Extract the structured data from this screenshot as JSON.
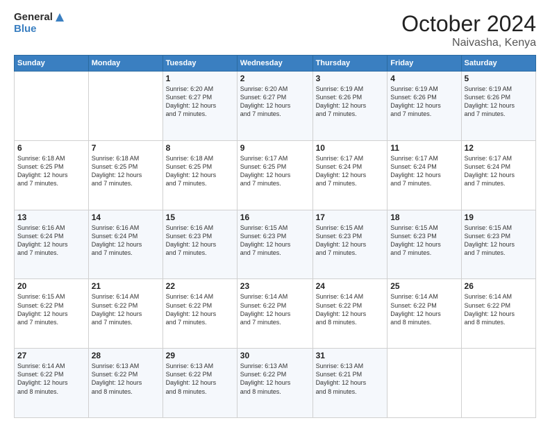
{
  "header": {
    "logo_text_general": "General",
    "logo_text_blue": "Blue",
    "month": "October 2024",
    "location": "Naivasha, Kenya"
  },
  "days_of_week": [
    "Sunday",
    "Monday",
    "Tuesday",
    "Wednesday",
    "Thursday",
    "Friday",
    "Saturday"
  ],
  "weeks": [
    [
      {
        "day": "",
        "info": ""
      },
      {
        "day": "",
        "info": ""
      },
      {
        "day": "1",
        "info": "Sunrise: 6:20 AM\nSunset: 6:27 PM\nDaylight: 12 hours\nand 7 minutes."
      },
      {
        "day": "2",
        "info": "Sunrise: 6:20 AM\nSunset: 6:27 PM\nDaylight: 12 hours\nand 7 minutes."
      },
      {
        "day": "3",
        "info": "Sunrise: 6:19 AM\nSunset: 6:26 PM\nDaylight: 12 hours\nand 7 minutes."
      },
      {
        "day": "4",
        "info": "Sunrise: 6:19 AM\nSunset: 6:26 PM\nDaylight: 12 hours\nand 7 minutes."
      },
      {
        "day": "5",
        "info": "Sunrise: 6:19 AM\nSunset: 6:26 PM\nDaylight: 12 hours\nand 7 minutes."
      }
    ],
    [
      {
        "day": "6",
        "info": "Sunrise: 6:18 AM\nSunset: 6:25 PM\nDaylight: 12 hours\nand 7 minutes."
      },
      {
        "day": "7",
        "info": "Sunrise: 6:18 AM\nSunset: 6:25 PM\nDaylight: 12 hours\nand 7 minutes."
      },
      {
        "day": "8",
        "info": "Sunrise: 6:18 AM\nSunset: 6:25 PM\nDaylight: 12 hours\nand 7 minutes."
      },
      {
        "day": "9",
        "info": "Sunrise: 6:17 AM\nSunset: 6:25 PM\nDaylight: 12 hours\nand 7 minutes."
      },
      {
        "day": "10",
        "info": "Sunrise: 6:17 AM\nSunset: 6:24 PM\nDaylight: 12 hours\nand 7 minutes."
      },
      {
        "day": "11",
        "info": "Sunrise: 6:17 AM\nSunset: 6:24 PM\nDaylight: 12 hours\nand 7 minutes."
      },
      {
        "day": "12",
        "info": "Sunrise: 6:17 AM\nSunset: 6:24 PM\nDaylight: 12 hours\nand 7 minutes."
      }
    ],
    [
      {
        "day": "13",
        "info": "Sunrise: 6:16 AM\nSunset: 6:24 PM\nDaylight: 12 hours\nand 7 minutes."
      },
      {
        "day": "14",
        "info": "Sunrise: 6:16 AM\nSunset: 6:24 PM\nDaylight: 12 hours\nand 7 minutes."
      },
      {
        "day": "15",
        "info": "Sunrise: 6:16 AM\nSunset: 6:23 PM\nDaylight: 12 hours\nand 7 minutes."
      },
      {
        "day": "16",
        "info": "Sunrise: 6:15 AM\nSunset: 6:23 PM\nDaylight: 12 hours\nand 7 minutes."
      },
      {
        "day": "17",
        "info": "Sunrise: 6:15 AM\nSunset: 6:23 PM\nDaylight: 12 hours\nand 7 minutes."
      },
      {
        "day": "18",
        "info": "Sunrise: 6:15 AM\nSunset: 6:23 PM\nDaylight: 12 hours\nand 7 minutes."
      },
      {
        "day": "19",
        "info": "Sunrise: 6:15 AM\nSunset: 6:23 PM\nDaylight: 12 hours\nand 7 minutes."
      }
    ],
    [
      {
        "day": "20",
        "info": "Sunrise: 6:15 AM\nSunset: 6:22 PM\nDaylight: 12 hours\nand 7 minutes."
      },
      {
        "day": "21",
        "info": "Sunrise: 6:14 AM\nSunset: 6:22 PM\nDaylight: 12 hours\nand 7 minutes."
      },
      {
        "day": "22",
        "info": "Sunrise: 6:14 AM\nSunset: 6:22 PM\nDaylight: 12 hours\nand 7 minutes."
      },
      {
        "day": "23",
        "info": "Sunrise: 6:14 AM\nSunset: 6:22 PM\nDaylight: 12 hours\nand 7 minutes."
      },
      {
        "day": "24",
        "info": "Sunrise: 6:14 AM\nSunset: 6:22 PM\nDaylight: 12 hours\nand 8 minutes."
      },
      {
        "day": "25",
        "info": "Sunrise: 6:14 AM\nSunset: 6:22 PM\nDaylight: 12 hours\nand 8 minutes."
      },
      {
        "day": "26",
        "info": "Sunrise: 6:14 AM\nSunset: 6:22 PM\nDaylight: 12 hours\nand 8 minutes."
      }
    ],
    [
      {
        "day": "27",
        "info": "Sunrise: 6:14 AM\nSunset: 6:22 PM\nDaylight: 12 hours\nand 8 minutes."
      },
      {
        "day": "28",
        "info": "Sunrise: 6:13 AM\nSunset: 6:22 PM\nDaylight: 12 hours\nand 8 minutes."
      },
      {
        "day": "29",
        "info": "Sunrise: 6:13 AM\nSunset: 6:22 PM\nDaylight: 12 hours\nand 8 minutes."
      },
      {
        "day": "30",
        "info": "Sunrise: 6:13 AM\nSunset: 6:22 PM\nDaylight: 12 hours\nand 8 minutes."
      },
      {
        "day": "31",
        "info": "Sunrise: 6:13 AM\nSunset: 6:21 PM\nDaylight: 12 hours\nand 8 minutes."
      },
      {
        "day": "",
        "info": ""
      },
      {
        "day": "",
        "info": ""
      }
    ]
  ]
}
